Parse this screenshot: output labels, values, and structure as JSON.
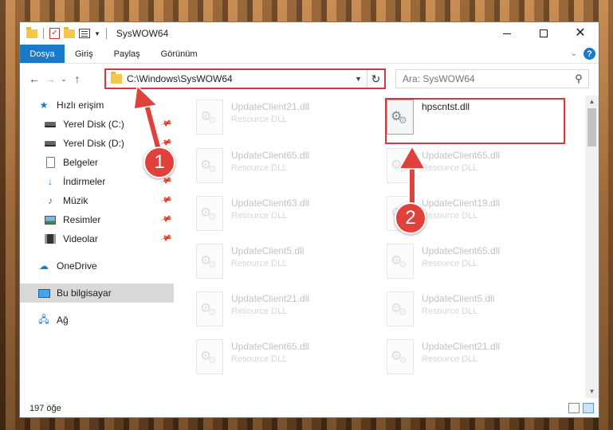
{
  "window": {
    "title": "SysWOW64"
  },
  "ribbon": {
    "tabs": [
      "Dosya",
      "Giriş",
      "Paylaş",
      "Görünüm"
    ]
  },
  "address": {
    "path": "C:\\Windows\\SysWOW64"
  },
  "search": {
    "placeholder": "Ara: SysWOW64"
  },
  "sidebar": {
    "items": [
      {
        "label": "Hızlı erişim"
      },
      {
        "label": "Yerel Disk (C:)"
      },
      {
        "label": "Yerel Disk (D:)"
      },
      {
        "label": "Belgeler"
      },
      {
        "label": "İndirmeler"
      },
      {
        "label": "Müzik"
      },
      {
        "label": "Resimler"
      },
      {
        "label": "Videolar"
      },
      {
        "label": "OneDrive"
      },
      {
        "label": "Bu bilgisayar"
      },
      {
        "label": "Ağ"
      }
    ]
  },
  "files": [
    {
      "name": "UpdateClient21.dll",
      "type": "Resource DLL"
    },
    {
      "name": "hpscntst.dll",
      "type": ""
    },
    {
      "name": "UpdateClient65.dll",
      "type": "Resource DLL"
    },
    {
      "name": "UpdateClient65.dll",
      "type": "Resource DLL"
    },
    {
      "name": "UpdateClient63.dll",
      "type": "Resource DLL"
    },
    {
      "name": "UpdateClient19.dll",
      "type": "Resource DLL"
    },
    {
      "name": "UpdateClient5.dll",
      "type": "Resource DLL"
    },
    {
      "name": "UpdateClient65.dll",
      "type": "Resource DLL"
    },
    {
      "name": "UpdateClient21.dll",
      "type": "Resource DLL"
    },
    {
      "name": "UpdateClient5.dll",
      "type": "Resource DLL"
    },
    {
      "name": "UpdateClient65.dll",
      "type": "Resource DLL"
    },
    {
      "name": "UpdateClient21.dll",
      "type": "Resource DLL"
    }
  ],
  "status": {
    "count": "197 öğe"
  },
  "annotations": {
    "badge1": "1",
    "badge2": "2"
  },
  "colors": {
    "accent": "#1979ca",
    "annotation": "#e0413a"
  }
}
